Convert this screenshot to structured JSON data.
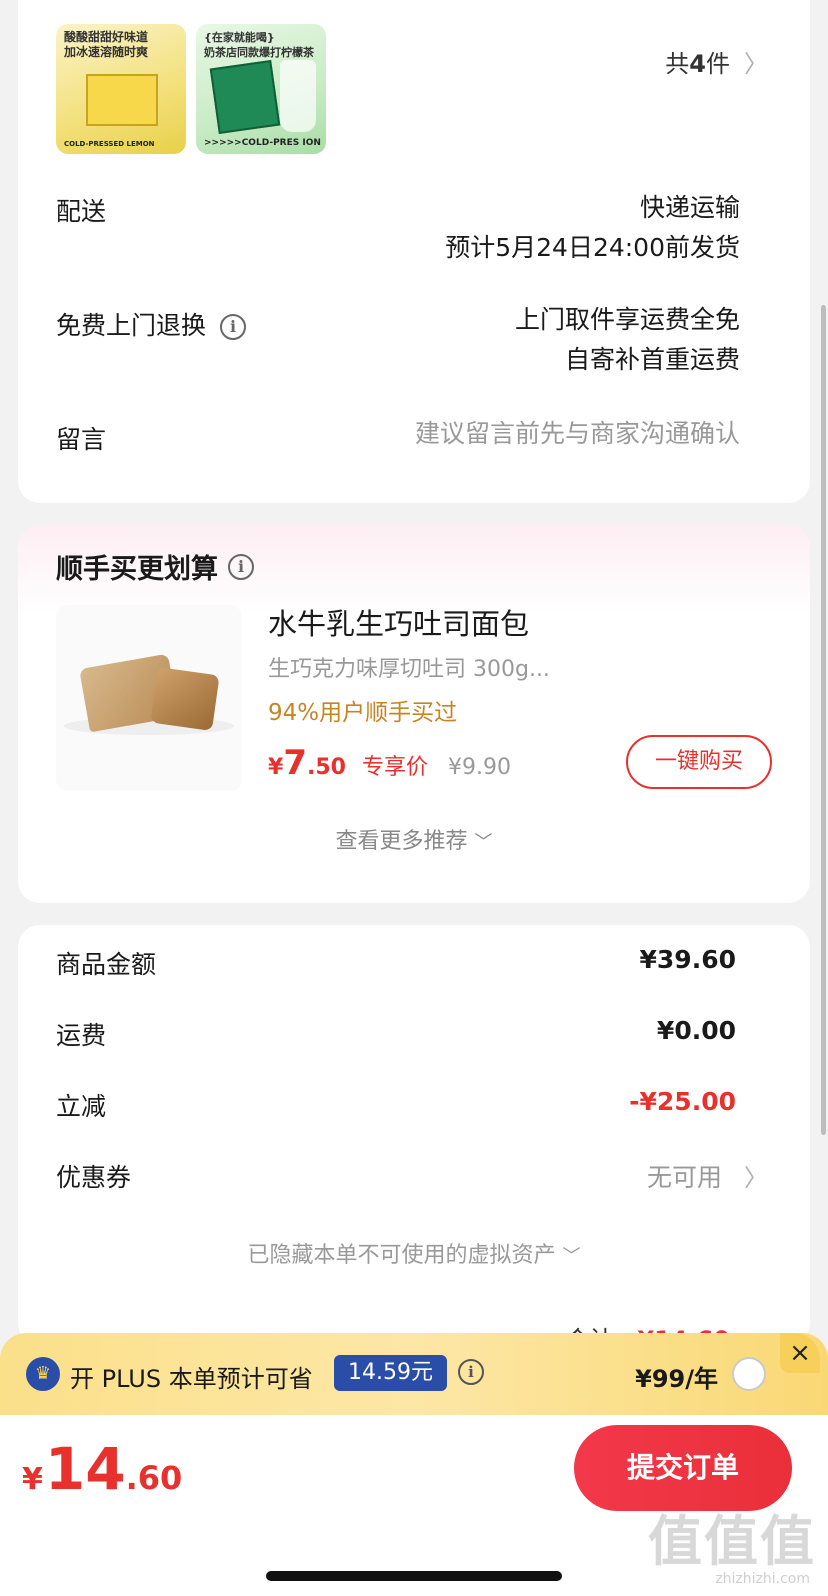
{
  "order": {
    "products": [
      {
        "tagline": "酸酸甜甜好味道\n加冰速溶随时爽",
        "pack_text": "COLD-PRESSED LEMON",
        "color": "#f2e07a"
      },
      {
        "tagline": "{在家就能喝}\n奶茶店同款爆打柠檬茶",
        "pack_text": ">>>>>COLD-PRES        ION",
        "color": "#c8ebc5"
      }
    ],
    "count_prefix": "共",
    "count_value": "4",
    "count_suffix": "件"
  },
  "delivery": {
    "label": "配送",
    "method": "快递运输",
    "eta": "预计5月24日24:00前发货"
  },
  "returns": {
    "label": "免费上门退换",
    "line1": "上门取件享运费全免",
    "line2": "自寄补首重运费"
  },
  "message": {
    "label": "留言",
    "placeholder": "建议留言前先与商家沟通确认"
  },
  "addon": {
    "title": "顺手买更划算",
    "product": {
      "name": "水牛乳生巧吐司面包",
      "desc": "生巧克力味厚切吐司 300g...",
      "social": "94%用户顺手买过",
      "currency": "¥",
      "price_int": "7",
      "price_dec": ".50",
      "price_tag": "专享价",
      "orig_price": "¥9.90",
      "buy_label": "一键购买"
    },
    "more_label": "查看更多推荐"
  },
  "summary": {
    "rows": [
      {
        "label": "商品金额",
        "value": "¥39.60"
      },
      {
        "label": "运费",
        "value": "¥0.00"
      },
      {
        "label": "立减",
        "value": "-¥25.00"
      }
    ],
    "coupon_label": "优惠券",
    "coupon_value": "无可用",
    "hidden_assets": "已隐藏本单不可使用的虚拟资产",
    "total_label": "合计：",
    "total_value": "¥14.60"
  },
  "plus": {
    "text": "开 PLUS 本单预计可省",
    "badge": "14.59元",
    "price": "¥99/年",
    "close": "×"
  },
  "footer": {
    "currency": "¥",
    "total_int": "14",
    "total_dec": ".60",
    "submit_label": "提交订单",
    "watermark": "值值值",
    "watermark_sub": "zhizhizhi.com"
  },
  "colors": {
    "accent_red": "#e8312d",
    "plus_blue": "#2a4da8",
    "plus_gold": "#fbe08a",
    "social_orange": "#c88424"
  }
}
